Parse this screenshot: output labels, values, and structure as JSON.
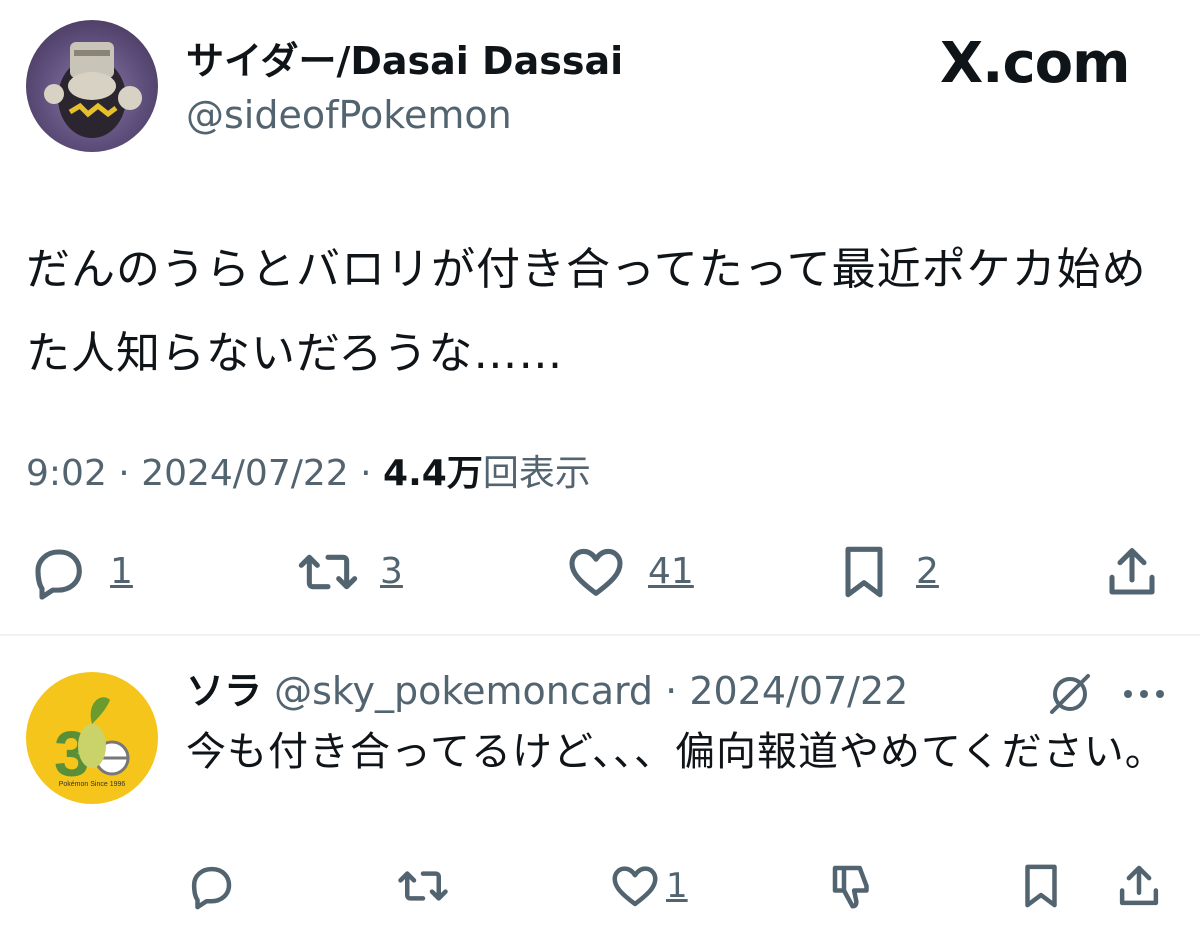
{
  "tweet": {
    "author_name": "サイダー/Dasai Dassai",
    "author_handle": "@sideofPokemon",
    "site_label": "X.com",
    "text": "だんのうらとバロリが付き合ってたって最近ポケカ始めた人知らないだろうな……",
    "time": "9:02",
    "date": "2024/07/22",
    "views_count": "4.4",
    "views_unit": "万",
    "views_label": "回表示",
    "reply_count": "1",
    "retweet_count": "3",
    "like_count": "41",
    "bookmark_count": "2"
  },
  "reply": {
    "author_name": "ソラ",
    "author_handle": "@sky_pokemoncard",
    "date": "2024/07/22",
    "text": "今も付き合ってるけど、、、偏向報道やめてください。",
    "avatar_caption": "Pokémon Since 1996",
    "like_count": "1"
  },
  "icons": {
    "reply": "speech-bubble-icon",
    "retweet": "retweet-icon",
    "like": "heart-icon",
    "bookmark": "bookmark-icon",
    "share": "share-icon",
    "grok": "grok-icon",
    "more": "more-dots-icon",
    "dislike": "thumbs-down-icon"
  },
  "colors": {
    "text": "#0f1419",
    "secondary": "#536471",
    "divider": "#eff3f4",
    "reply_avatar": "#f5c51b"
  }
}
